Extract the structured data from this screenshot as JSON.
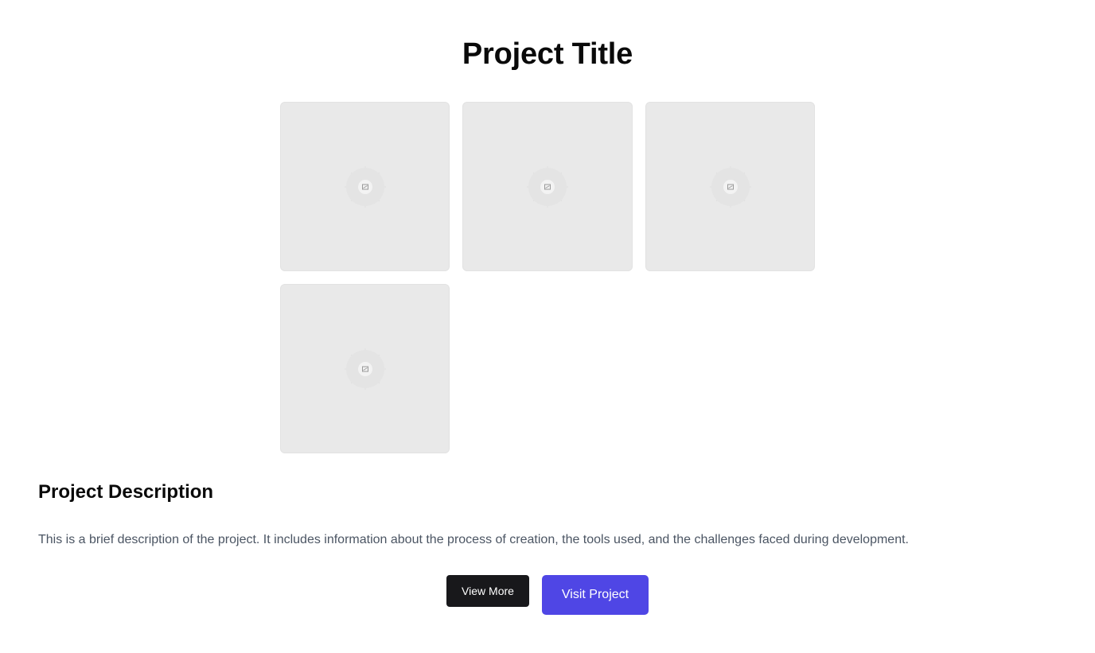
{
  "page": {
    "title": "Project Title"
  },
  "gallery": {
    "images": [
      {
        "icon": "image-placeholder-icon"
      },
      {
        "icon": "image-placeholder-icon"
      },
      {
        "icon": "image-placeholder-icon"
      },
      {
        "icon": "image-placeholder-icon"
      }
    ],
    "placeholder_color": "#e9e9e9"
  },
  "description": {
    "heading": "Project Description",
    "body": "This is a brief description of the project. It includes information about the process of creation, the tools used, and the challenges faced during development."
  },
  "actions": {
    "view_more_label": "View More",
    "visit_project_label": "Visit Project"
  },
  "colors": {
    "primary": "#4f46e5",
    "dark_button": "#18181b",
    "muted_text": "#4b5563"
  }
}
